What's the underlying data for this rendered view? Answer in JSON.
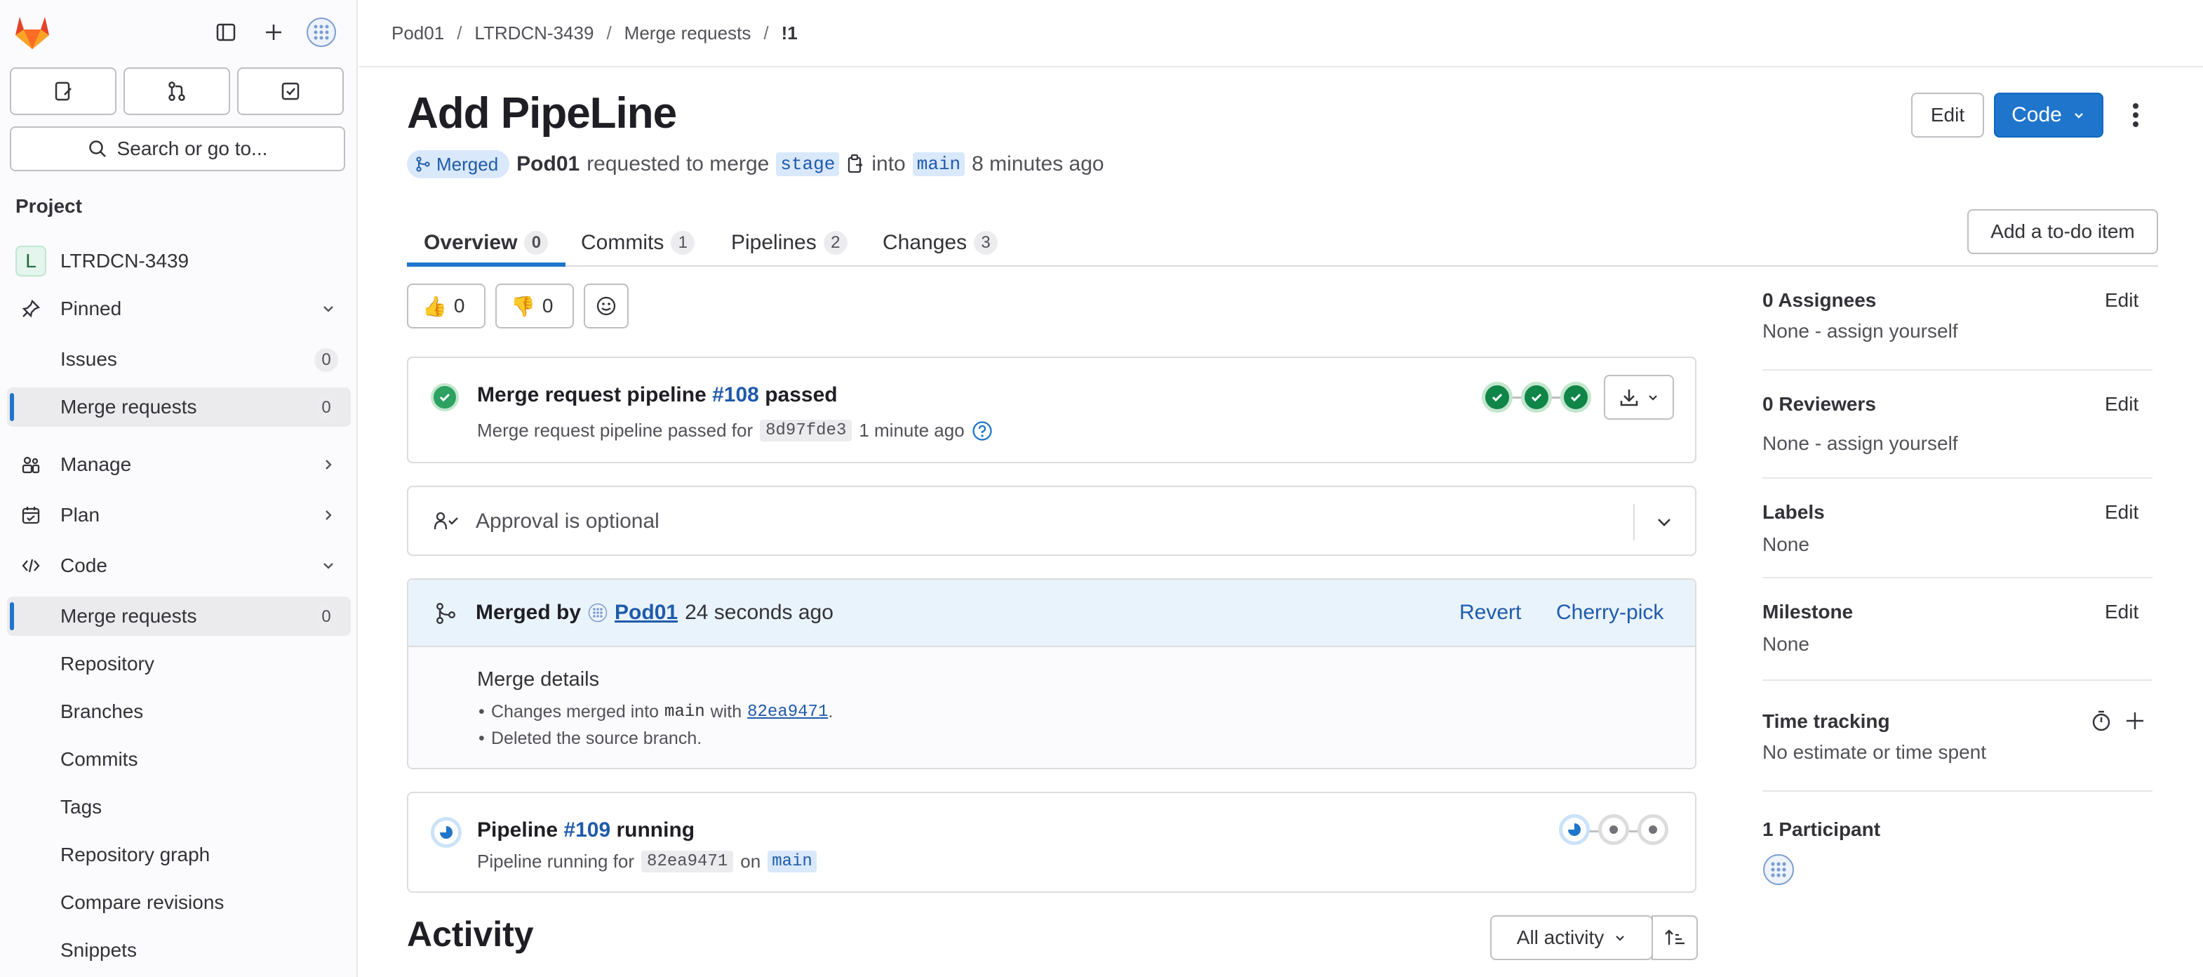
{
  "sidebar": {
    "search_label": "Search or go to...",
    "section_heading": "Project",
    "project_initial": "L",
    "project_name": "LTRDCN-3439",
    "pinned": {
      "label": "Pinned",
      "items": [
        {
          "label": "Issues",
          "count": "0"
        },
        {
          "label": "Merge requests",
          "count": "0"
        }
      ]
    },
    "groups": [
      {
        "label": "Manage"
      },
      {
        "label": "Plan"
      },
      {
        "label": "Code"
      }
    ],
    "code_items": [
      {
        "label": "Merge requests",
        "count": "0"
      },
      {
        "label": "Repository"
      },
      {
        "label": "Branches"
      },
      {
        "label": "Commits"
      },
      {
        "label": "Tags"
      },
      {
        "label": "Repository graph"
      },
      {
        "label": "Compare revisions"
      },
      {
        "label": "Snippets"
      }
    ]
  },
  "breadcrumb": [
    "Pod01",
    "LTRDCN-3439",
    "Merge requests",
    "!1"
  ],
  "mr": {
    "title": "Add PipeLine",
    "status": "Merged",
    "author": "Pod01",
    "requested_text": "requested to merge",
    "source_branch": "stage",
    "into_text": "into",
    "target_branch": "main",
    "time_ago": "8 minutes ago"
  },
  "header_buttons": {
    "edit": "Edit",
    "code": "Code",
    "todo": "Add a to-do item"
  },
  "tabs": [
    {
      "label": "Overview",
      "count": "0"
    },
    {
      "label": "Commits",
      "count": "1"
    },
    {
      "label": "Pipelines",
      "count": "2"
    },
    {
      "label": "Changes",
      "count": "3"
    }
  ],
  "reactions": {
    "thumbs_up_emoji": "👍",
    "thumbs_up_count": "0",
    "thumbs_down_emoji": "👎",
    "thumbs_down_count": "0"
  },
  "pipeline_card": {
    "prefix": "Merge request pipeline",
    "id": "#108",
    "status_word": "passed",
    "sub_text": "Merge request pipeline passed for",
    "sha": "8d97fde3",
    "time": "1 minute ago"
  },
  "approval": {
    "text": "Approval is optional"
  },
  "merged_card": {
    "merged_by_label": "Merged by",
    "user": "Pod01",
    "time": "24 seconds ago",
    "revert": "Revert",
    "cherry_pick": "Cherry-pick",
    "details_title": "Merge details",
    "line1_prefix": "Changes merged into",
    "line1_branch": "main",
    "line1_with": "with",
    "line1_sha": "82ea9471",
    "line1_suffix": ".",
    "line2": "Deleted the source branch."
  },
  "running_card": {
    "prefix": "Pipeline",
    "id": "#109",
    "status_word": "running",
    "sub_prefix": "Pipeline running for",
    "sha": "82ea9471",
    "on_text": "on",
    "branch": "main"
  },
  "activity": {
    "title": "Activity",
    "filter": "All activity"
  },
  "right_sidebar": {
    "assignees_title": "0 Assignees",
    "assignees_value": "None - assign yourself",
    "reviewers_title": "0 Reviewers",
    "reviewers_value": "None - assign yourself",
    "labels_title": "Labels",
    "labels_value": "None",
    "milestone_title": "Milestone",
    "milestone_value": "None",
    "time_title": "Time tracking",
    "time_value": "No estimate or time spent",
    "participants_title": "1 Participant",
    "edit": "Edit"
  },
  "colors": {
    "accent": "#1f75cb",
    "success": "#108548",
    "merged_badge_bg": "#d9e8fb"
  }
}
